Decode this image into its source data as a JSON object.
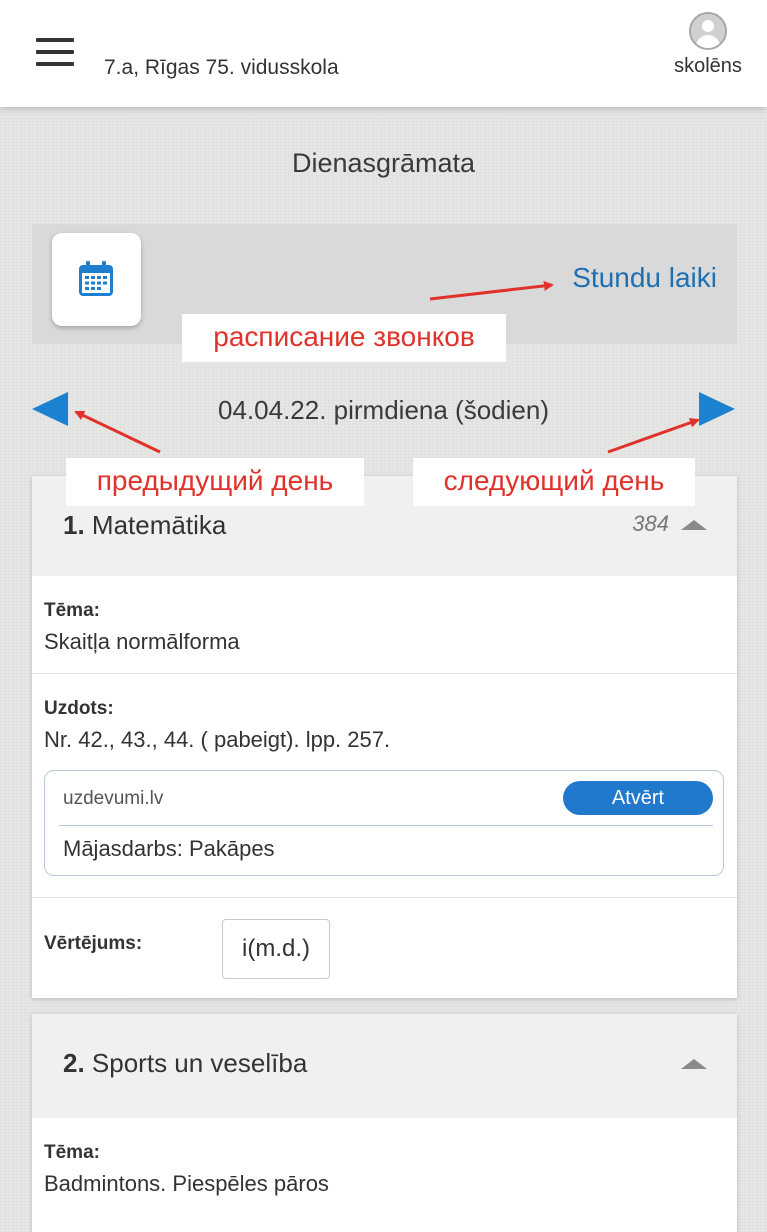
{
  "header": {
    "school": "7.a, Rīgas 75. vidusskola",
    "user_role": "skolēns"
  },
  "page_title": "Dienasgrāmata",
  "schedule": {
    "bell_times_link": "Stundu laiki"
  },
  "annotations": {
    "bells": "расписание звонков",
    "prev_day": "предыдущий день",
    "next_day": "следующий день"
  },
  "date_nav": {
    "date": "04.04.22. pirmdiena (šodien)"
  },
  "lessons": [
    {
      "number": "1.",
      "name": "Matemātika",
      "room": "384",
      "topic_label": "Tēma:",
      "topic": "Skaitļa normālforma",
      "homework_label": "Uzdots:",
      "homework": "Nr. 42., 43., 44. ( pabeigt). lpp. 257.",
      "attachment": {
        "source": "uzdevumi.lv",
        "open_label": "Atvērt",
        "title": "Mājasdarbs: Pakāpes"
      },
      "grade_label": "Vērtējums:",
      "grade": "i(m.d.)"
    },
    {
      "number": "2.",
      "name": "Sports un veselība",
      "topic_label": "Tēma:",
      "topic": "Badmintons. Piespēles pāros"
    }
  ],
  "colors": {
    "accent": "#2079cc",
    "link": "#1f6fb3",
    "annotation": "#e0322b",
    "nav_arrow": "#1b82d1"
  }
}
